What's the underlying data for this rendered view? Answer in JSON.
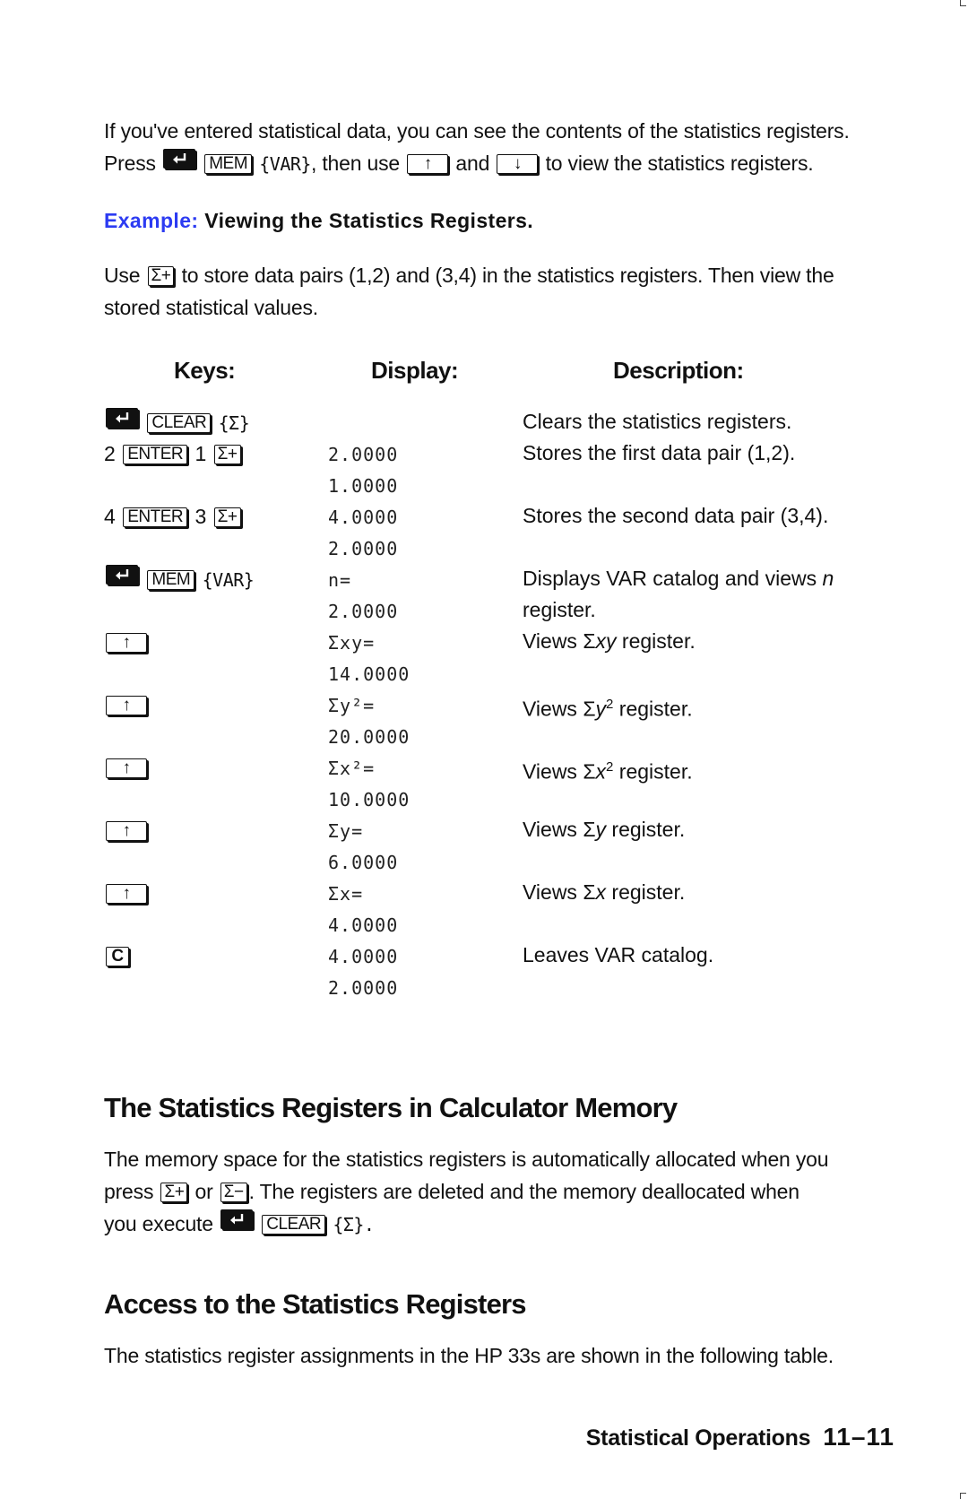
{
  "intro": {
    "text_1": "If you've entered statistical data, you can see the contents of the statistics registers.",
    "press": "Press",
    "mem_key": "MEM",
    "var_softkey": "{VAR}",
    "then_use": ", then use",
    "and": "and",
    "to_view": "to view the statistics registers."
  },
  "example": {
    "label": "Example:",
    "title": "Viewing the Statistics Registers.",
    "use": "Use",
    "sigma_plus_key": "Σ+",
    "body_1": "to store data pairs (1,2) and (3,4) in the statistics registers. Then view the",
    "body_2": "stored statistical values."
  },
  "table": {
    "headers": {
      "keys": "Keys:",
      "display": "Display:",
      "description": "Description:"
    },
    "rows": [
      {
        "keys": [
          "shift-key",
          "CLEAR",
          "{Σ}"
        ],
        "display": [
          "",
          ""
        ],
        "description": "Clears the statistics registers."
      },
      {
        "keys": [
          "2",
          "ENTER",
          "1",
          "Σ+"
        ],
        "display": [
          "2.0000",
          "1.0000"
        ],
        "description": "Stores the first data pair (1,2)."
      },
      {
        "keys": [
          "4",
          "ENTER",
          "3",
          "Σ+"
        ],
        "display": [
          "4.0000",
          "2.0000"
        ],
        "description": "Stores the second data pair (3,4)."
      },
      {
        "keys": [
          "shift-key",
          "MEM",
          "{VAR}"
        ],
        "display": [
          "n=",
          "2.0000"
        ],
        "description_a": "Displays VAR catalog and views",
        "description_var": "n",
        "description_b": "register."
      },
      {
        "keys": [
          "up-arrow"
        ],
        "display": [
          "Σxy=",
          "14.0000"
        ],
        "description_a": "Views Σ",
        "description_var": "xy",
        "description_b": " register."
      },
      {
        "keys": [
          "up-arrow"
        ],
        "display": [
          "Σy²=",
          "20.0000"
        ],
        "description_a": "Views Σ",
        "description_var": "y",
        "description_sup": "2",
        "description_b": " register."
      },
      {
        "keys": [
          "up-arrow"
        ],
        "display": [
          "Σx²=",
          "10.0000"
        ],
        "description_a": "Views Σ",
        "description_var": "x",
        "description_sup": "2",
        "description_b": " register."
      },
      {
        "keys": [
          "up-arrow"
        ],
        "display": [
          "Σy=",
          "6.0000"
        ],
        "description_a": "Views Σ",
        "description_var": "y",
        "description_b": " register."
      },
      {
        "keys": [
          "up-arrow"
        ],
        "display": [
          "Σx=",
          "4.0000"
        ],
        "description_a": "Views Σ",
        "description_var": "x",
        "description_b": " register."
      },
      {
        "keys": [
          "C"
        ],
        "display": [
          "4.0000",
          "2.0000"
        ],
        "description": "Leaves VAR catalog."
      }
    ]
  },
  "section_memory": {
    "heading": "The Statistics Registers in Calculator Memory",
    "line_1": "The memory space for the statistics registers is automatically allocated when you",
    "press": "press",
    "sigma_plus_key": "Σ+",
    "or": "or",
    "sigma_minus_key": "Σ−",
    "line_2_rest": ". The registers are deleted and the memory deallocated when",
    "you_execute": "you execute",
    "clear_key": "CLEAR",
    "sigma_softkey": "{Σ}."
  },
  "section_access": {
    "heading": "Access to the Statistics Registers",
    "line_1": "The statistics register assignments in the HP 33s are shown in the following table."
  },
  "footer": {
    "chapter": "Statistical Operations",
    "page": "11–11"
  }
}
